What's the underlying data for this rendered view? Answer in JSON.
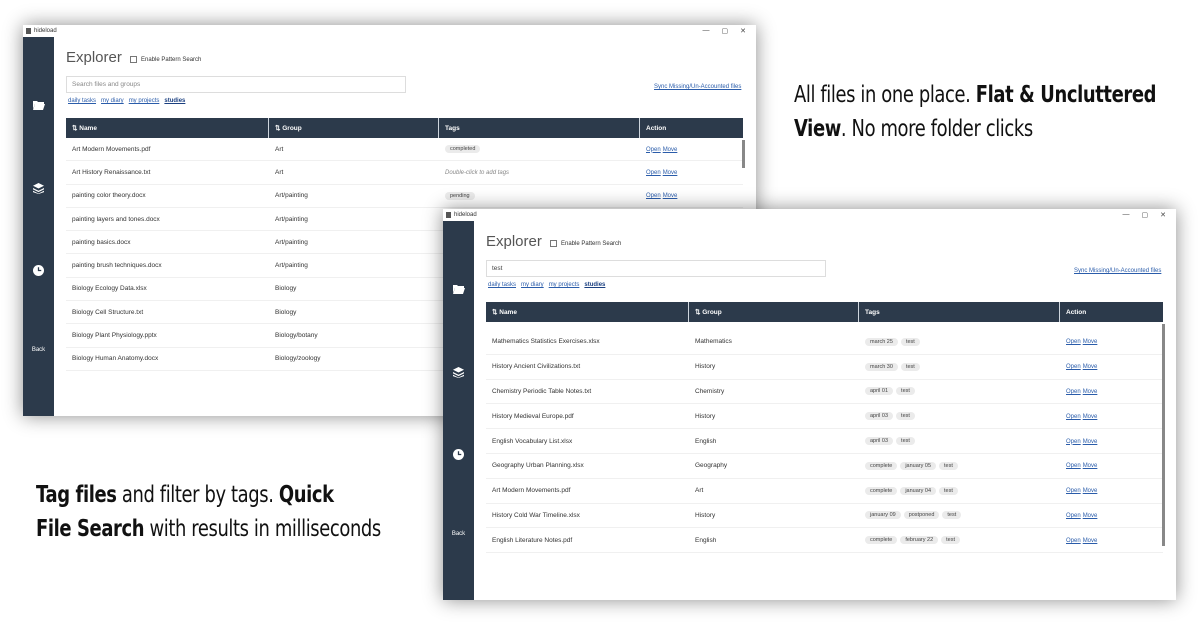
{
  "app_title": "hideload",
  "window_controls": [
    "—",
    "▢",
    "✕"
  ],
  "explorer_title": "Explorer",
  "pattern_search_label": "Enable Pattern Search",
  "sidebar": {
    "back_label": "Back",
    "icons": [
      "folder-open-icon",
      "layers-icon",
      "clock-icon"
    ]
  },
  "sync_link": "Sync Missing/Un-Accounted files",
  "quick_filters": [
    "daily tasks",
    "my diary",
    "my projects",
    "studies"
  ],
  "columns": [
    "⇅ Name",
    "⇅ Group",
    "Tags",
    "Action"
  ],
  "actions": {
    "open": "Open",
    "move": "Move"
  },
  "window1": {
    "search_placeholder": "Search files and groups",
    "rows": [
      {
        "name": "Art Modern Movements.pdf",
        "group": "Art",
        "tags": [
          "completed"
        ]
      },
      {
        "name": "Art History Renaissance.txt",
        "group": "Art",
        "hint": "Double-click to add tags"
      },
      {
        "name": "painting color theory.docx",
        "group": "Art/painting",
        "tags": [
          "pending"
        ]
      },
      {
        "name": "painting layers and tones.docx",
        "group": "Art/painting"
      },
      {
        "name": "painting basics.docx",
        "group": "Art/painting"
      },
      {
        "name": "painting brush techniques.docx",
        "group": "Art/painting"
      },
      {
        "name": "Biology Ecology Data.xlsx",
        "group": "Biology"
      },
      {
        "name": "Biology Cell Structure.txt",
        "group": "Biology"
      },
      {
        "name": "Biology Plant Physiology.pptx",
        "group": "Biology/botany"
      },
      {
        "name": "Biology Human Anatomy.docx",
        "group": "Biology/zoology"
      }
    ]
  },
  "window2": {
    "search_value": "test",
    "rows": [
      {
        "name": "Mathematics Statistics Exercises.xlsx",
        "group": "Mathematics",
        "tags": [
          "march 25",
          "test"
        ]
      },
      {
        "name": "History Ancient Civilizations.txt",
        "group": "History",
        "tags": [
          "march 30",
          "test"
        ]
      },
      {
        "name": "Chemistry Periodic Table Notes.txt",
        "group": "Chemistry",
        "tags": [
          "april 01",
          "test"
        ]
      },
      {
        "name": "History Medieval Europe.pdf",
        "group": "History",
        "tags": [
          "april 03",
          "test"
        ]
      },
      {
        "name": "English Vocabulary List.xlsx",
        "group": "English",
        "tags": [
          "april 03",
          "test"
        ]
      },
      {
        "name": "Geography Urban Planning.xlsx",
        "group": "Geography",
        "tags": [
          "complete",
          "january 05",
          "test"
        ]
      },
      {
        "name": "Art Modern Movements.pdf",
        "group": "Art",
        "tags": [
          "complete",
          "january 04",
          "test"
        ]
      },
      {
        "name": "History Cold War Timeline.xlsx",
        "group": "History",
        "tags": [
          "january 09",
          "postponed",
          "test"
        ]
      },
      {
        "name": "English Literature Notes.pdf",
        "group": "English",
        "tags": [
          "complete",
          "february 22",
          "test"
        ]
      }
    ]
  },
  "caption_top": [
    {
      "text": "All files in one place. ",
      "bold": false
    },
    {
      "text": "Flat & Uncluttered",
      "bold": true
    },
    {
      "text": "View",
      "bold": true,
      "newline": true
    },
    {
      "text": ". No more folder clicks",
      "bold": false
    }
  ],
  "caption_bottom": [
    {
      "text": "Tag files",
      "bold": true
    },
    {
      "text": " and filter by tags. ",
      "bold": false
    },
    {
      "text": "Quick",
      "bold": true
    },
    {
      "text": "File Search",
      "bold": true,
      "newline": true
    },
    {
      "text": " with results in milliseconds",
      "bold": false
    }
  ],
  "colors": {
    "sidebar": "#2c3a4b",
    "header": "#2c3a4b",
    "link": "#2a5caa"
  }
}
